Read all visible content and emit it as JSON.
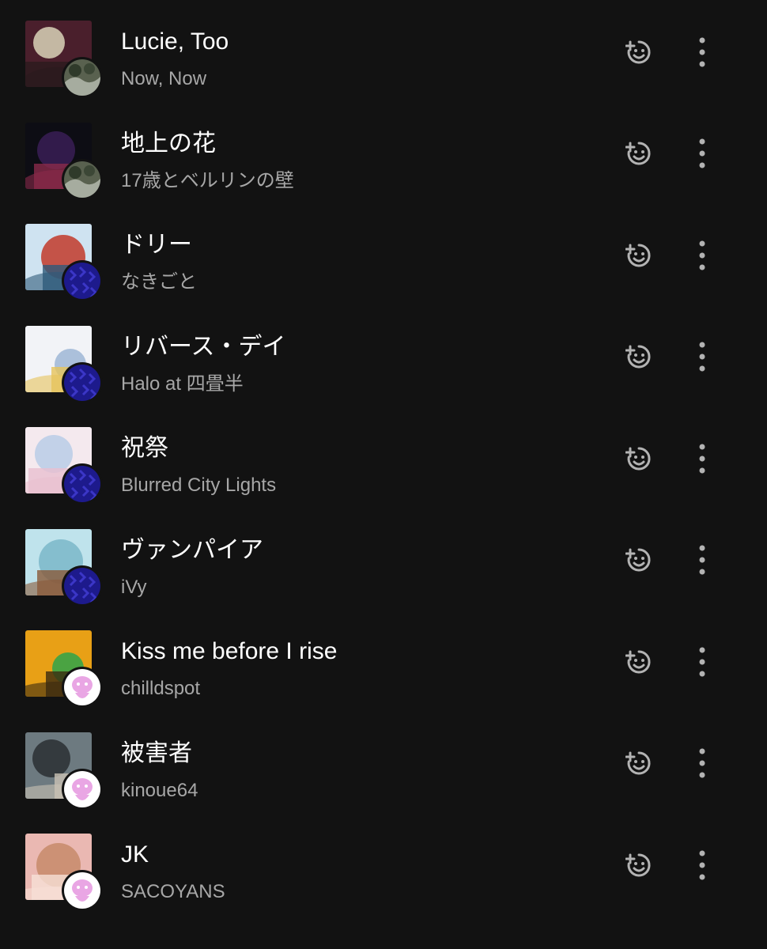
{
  "tracks": [
    {
      "title": "Lucie, Too",
      "artist": "Now, Now",
      "art_colors": [
        "#4a1f2c",
        "#d9d3b8",
        "#2a1a1e"
      ],
      "avatar_type": "photo",
      "avatar_colors": [
        "#59614f",
        "#c8ccc2"
      ]
    },
    {
      "title": "地上の花",
      "artist": "17歳とベルリンの壁",
      "art_colors": [
        "#0d0d14",
        "#3a1f55",
        "#8a2a4a"
      ],
      "avatar_type": "photo",
      "avatar_colors": [
        "#59614f",
        "#c8ccc2"
      ]
    },
    {
      "title": "ドリー",
      "artist": "なきごと",
      "art_colors": [
        "#cfe3f1",
        "#c23a2a",
        "#2e5a7a"
      ],
      "avatar_type": "pattern",
      "avatar_colors": [
        "#1d1a8c",
        "#3b36c7"
      ]
    },
    {
      "title": "リバース・デイ",
      "artist": "Halo at 四畳半",
      "art_colors": [
        "#f2f3f7",
        "#9fb6d6",
        "#e6c35a"
      ],
      "avatar_type": "pattern",
      "avatar_colors": [
        "#1d1a8c",
        "#3b36c7"
      ]
    },
    {
      "title": "祝祭",
      "artist": "Blurred City Lights",
      "art_colors": [
        "#f4e9ee",
        "#b9cde6",
        "#e9bfcf"
      ],
      "avatar_type": "pattern",
      "avatar_colors": [
        "#1d1a8c",
        "#3b36c7"
      ]
    },
    {
      "title": "ヴァンパイア",
      "artist": "iVy",
      "art_colors": [
        "#bfe3ec",
        "#7ab7c9",
        "#8a5a3a"
      ],
      "avatar_type": "pattern",
      "avatar_colors": [
        "#1d1a8c",
        "#3b36c7"
      ]
    },
    {
      "title": "Kiss me before I rise",
      "artist": "chilldspot",
      "art_colors": [
        "#e8a016",
        "#2ea34a",
        "#3a2a10"
      ],
      "avatar_type": "figure",
      "avatar_colors": [
        "#ffffff",
        "#e9a6e4"
      ]
    },
    {
      "title": "被害者",
      "artist": "kinoue64",
      "art_colors": [
        "#6d7a80",
        "#2a2f33",
        "#c9c2b4"
      ],
      "avatar_type": "figure",
      "avatar_colors": [
        "#ffffff",
        "#e9a6e4"
      ]
    },
    {
      "title": "JK",
      "artist": "SACOYANS",
      "art_colors": [
        "#eab8b2",
        "#c78a6a",
        "#f6e0d6"
      ],
      "avatar_type": "figure",
      "avatar_colors": [
        "#ffffff",
        "#e9a6e4"
      ]
    }
  ],
  "icons": {
    "add": "add-to-playlist-icon",
    "more": "more-options-icon"
  },
  "colors": {
    "background": "#121212",
    "title": "#ffffff",
    "subtitle": "#a7a7a7",
    "icon": "#b3b3b3"
  }
}
